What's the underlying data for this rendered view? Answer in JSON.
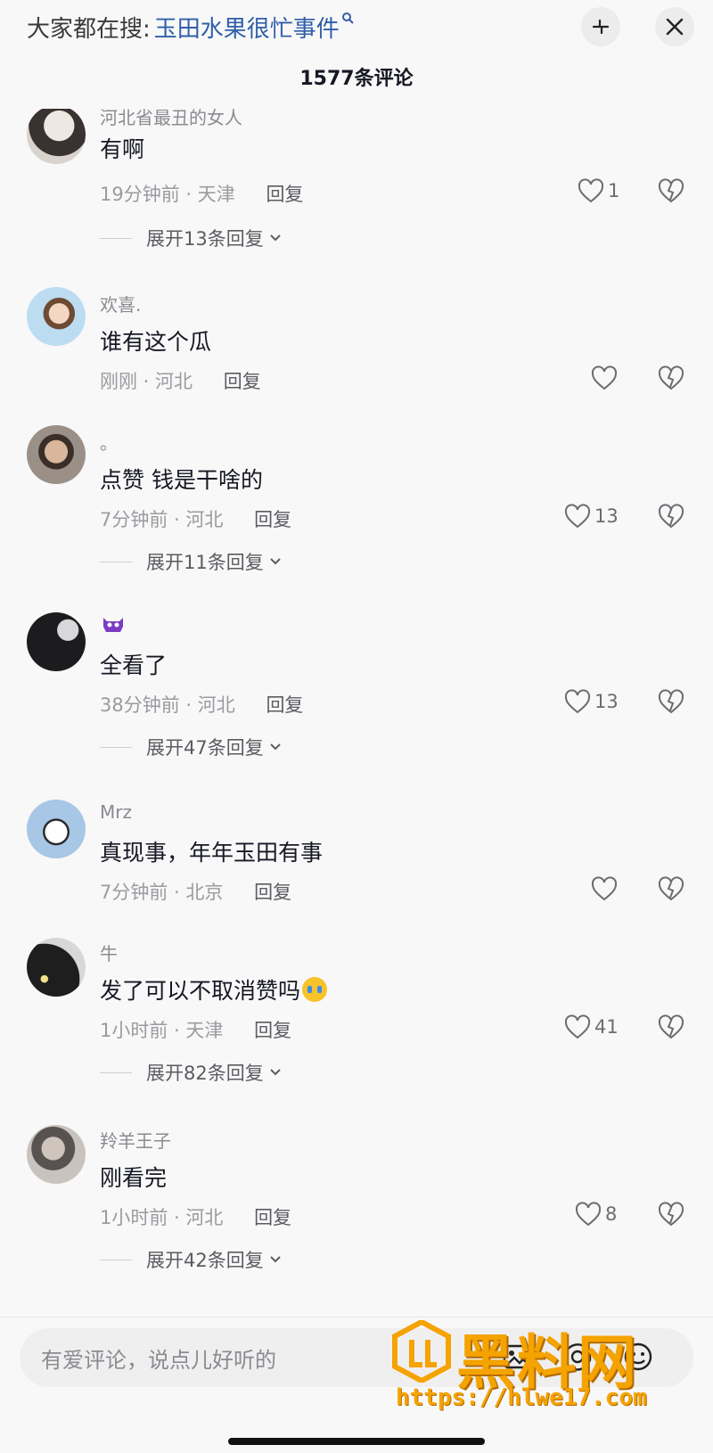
{
  "header": {
    "search_prefix": "大家都在搜:",
    "search_term": "玉田水果很忙事件",
    "comment_count": "1577条评论"
  },
  "comments": [
    {
      "username": "河北省最丑的女人",
      "text": "有啊",
      "time_location": "19分钟前 · 天津",
      "reply_label": "回复",
      "likes": "1",
      "expand_label": "展开13条回复",
      "avatar_color": "#c8c3be"
    },
    {
      "username": "欢喜.",
      "text": "谁有这个瓜",
      "time_location": "刚刚 · 河北",
      "reply_label": "回复",
      "likes": "",
      "expand_label": "",
      "avatar_color": "#b9d7f0"
    },
    {
      "username": "。",
      "text": "点赞 钱是干啥的",
      "time_location": "7分钟前 · 河北",
      "reply_label": "回复",
      "likes": "13",
      "expand_label": "展开11条回复",
      "avatar_color": "#a99c8f"
    },
    {
      "username": "",
      "username_icon": "purple-monster-emoji-icon",
      "text": "全看了",
      "time_location": "38分钟前 · 河北",
      "reply_label": "回复",
      "likes": "13",
      "expand_label": "展开47条回复",
      "avatar_color": "#2b2b2e"
    },
    {
      "username": "Mrz",
      "text": "真现事，年年玉田有事",
      "time_location": "7分钟前 · 北京",
      "reply_label": "回复",
      "likes": "",
      "expand_label": "",
      "avatar_color": "#a8c6e6"
    },
    {
      "username": "牛",
      "text": "发了可以不取消赞吗",
      "text_emoji": "crying-face-emoji-icon",
      "time_location": "1小时前 · 天津",
      "reply_label": "回复",
      "likes": "41",
      "expand_label": "展开82条回复",
      "avatar_color": "#1e1e1e"
    },
    {
      "username": "羚羊王子",
      "text": "刚看完",
      "time_location": "1小时前 · 河北",
      "reply_label": "回复",
      "likes": "8",
      "expand_label": "展开42条回复",
      "avatar_color": "#8f8a86"
    }
  ],
  "input_bar": {
    "placeholder": "有爱评论，说点儿好听的"
  },
  "watermark": {
    "title": "黑料网",
    "url": "https://hlwe17.com"
  }
}
